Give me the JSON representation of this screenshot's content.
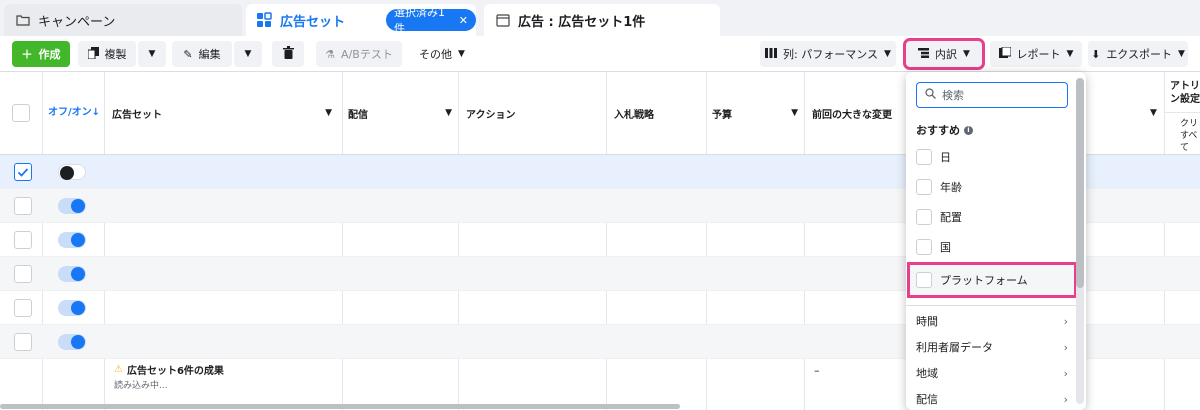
{
  "tabs": [
    {
      "label": "キャンペーン"
    },
    {
      "label": "広告セット",
      "chip": "選択済み1件"
    },
    {
      "label": "広告 : 広告セット1件"
    }
  ],
  "toolbar": {
    "create": "作成",
    "duplicate": "複製",
    "edit": "編集",
    "abtest": "A/Bテスト",
    "more": "その他",
    "columns": "列: パフォーマンス",
    "breakdown": "内訳",
    "reports": "レポート",
    "export": "エクスポート"
  },
  "table": {
    "headers": {
      "onoff": "オフ/オン↓",
      "adset": "広告セット",
      "delivery": "配信",
      "actions": "アクション",
      "bid": "入札戦略",
      "budget": "予算",
      "last_change": "前回の大きな変更",
      "attribution": "アトリ",
      "attribution2": "ン設定",
      "sub1": "クリ",
      "sub2": "すべて"
    },
    "rows": [
      {
        "selected": true,
        "on": false
      },
      {
        "selected": false,
        "on": true
      },
      {
        "selected": false,
        "on": true
      },
      {
        "selected": false,
        "on": true
      },
      {
        "selected": false,
        "on": true
      },
      {
        "selected": false,
        "on": true
      }
    ],
    "summary": {
      "title": "広告セット6件の成果",
      "loading": "読み込み中...",
      "dash": "–"
    }
  },
  "breakdown_menu": {
    "search_placeholder": "検索",
    "recommended_title": "おすすめ",
    "recommended": [
      "日",
      "年齢",
      "配置",
      "国",
      "プラットフォーム"
    ],
    "submenus": [
      "時間",
      "利用者層データ",
      "地域",
      "配信"
    ]
  },
  "colors": {
    "accent": "#1877f2",
    "create": "#42b72a",
    "highlight": "#e83e8c"
  }
}
